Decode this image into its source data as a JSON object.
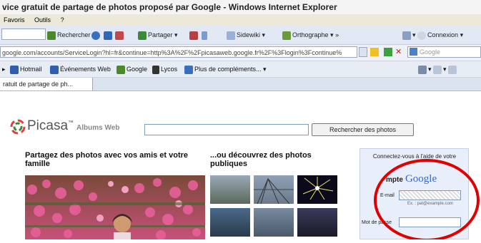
{
  "window": {
    "title": "vice gratuit de partage de photos proposé par Google - Windows Internet Explorer"
  },
  "menu": {
    "items": [
      "Favoris",
      "Outils",
      "?"
    ]
  },
  "toolbar": {
    "search_label": "Rechercher",
    "share_label": "Partager",
    "sidewiki_label": "Sidewiki",
    "spell_label": "Orthographe",
    "more": "»",
    "login_label": "Connexion"
  },
  "address": {
    "url": "google.com/accounts/ServiceLogin?hl=fr&continue=http%3A%2F%2Fpicasaweb.google.fr%2F%3Flogin%3Fcontinue%",
    "search_placeholder": "Google"
  },
  "favorites": {
    "hotmail": "Hotmail",
    "events": "Événements Web",
    "google": "Google",
    "lycos": "Lycos",
    "addons": "Plus de compléments..."
  },
  "tab": {
    "label": "ratuit de partage de ph..."
  },
  "page": {
    "logo_text": "Picasa",
    "logo_tm": "™",
    "albums_label": "Albums Web",
    "search_button": "Rechercher des photos",
    "share_heading": "Partagez des photos avec vos amis et votre famille",
    "discover_heading": "...ou découvrez des photos publiques"
  },
  "login": {
    "intro": "Connectez-vous à l'aide de votre",
    "account_prefix": "mpte",
    "google": "Google",
    "email_label": "E-mail",
    "email_hint": "Ex. : pat@example.com",
    "password_label": "Mot de passe"
  },
  "colors": {
    "highlight_circle": "#e00000",
    "google_blue": "#3366cc"
  }
}
